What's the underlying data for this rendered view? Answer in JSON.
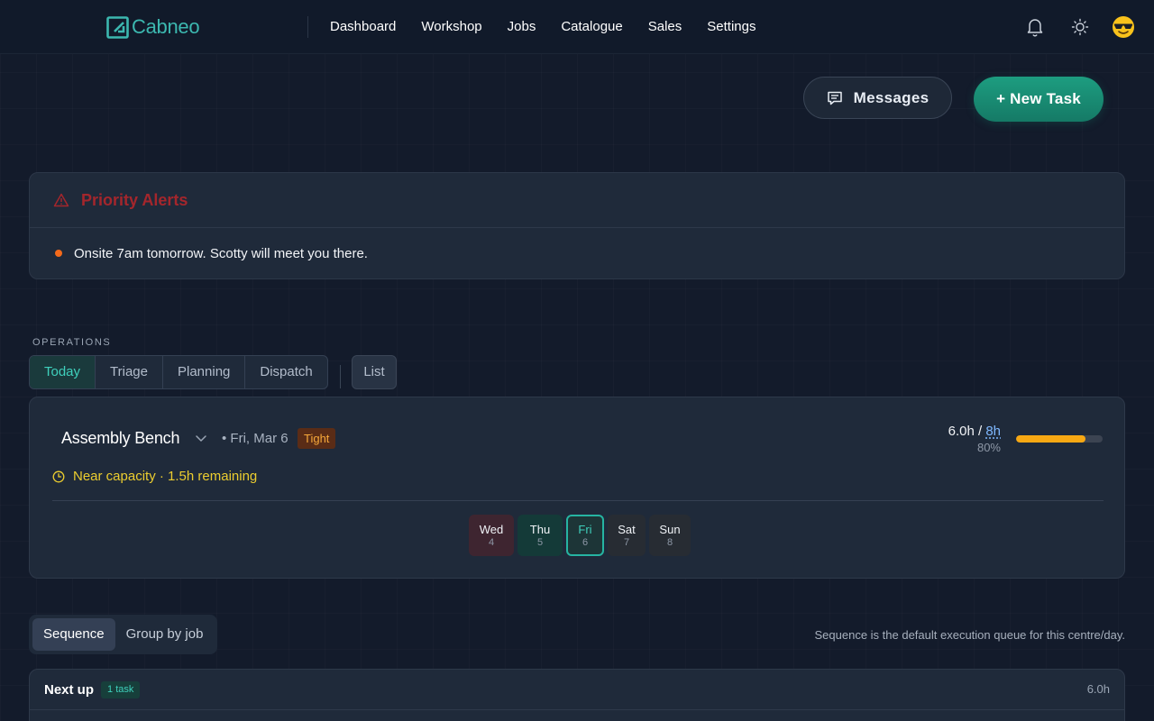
{
  "app": {
    "name": "Cabneo",
    "nav": [
      "Dashboard",
      "Workshop",
      "Jobs",
      "Catalogue",
      "Sales",
      "Settings"
    ]
  },
  "icons": {
    "logo": "cabneo-logo-icon",
    "notifications": "bell-icon",
    "theme": "sun-icon",
    "avatar": "sunglasses-emoji-avatar",
    "messages": "chat-bubble-icon",
    "alerts": "warning-triangle-icon",
    "bench_dropdown": "chevron-down-icon",
    "near_capacity": "clock-icon"
  },
  "actions": {
    "messages_label": "Messages",
    "new_task_label": "+ New Task"
  },
  "alerts": {
    "title": "Priority Alerts",
    "items": [
      "Onsite 7am tomorrow. Scotty will meet you there."
    ]
  },
  "operations": {
    "section_label": "OPERATIONS",
    "tabs": [
      "Today",
      "Triage",
      "Planning",
      "Dispatch"
    ],
    "active_tab": "Today",
    "list_label": "List"
  },
  "bench": {
    "title": "Assembly Bench",
    "date": "• Fri, Mar 6",
    "status_badge": "Tight",
    "hours_used": "6.0h /",
    "hours_max": "8h",
    "percent_label": "80%",
    "utilization": 0.8,
    "near_capacity_text": "Near capacity · 1.5h remaining",
    "days": [
      {
        "name": "Wed",
        "num": "4"
      },
      {
        "name": "Thu",
        "num": "5"
      },
      {
        "name": "Fri",
        "num": "6"
      },
      {
        "name": "Sat",
        "num": "7"
      },
      {
        "name": "Sun",
        "num": "8"
      }
    ],
    "selected_day": "Fri"
  },
  "sequence": {
    "modes": [
      "Sequence",
      "Group by job"
    ],
    "active_mode": "Sequence",
    "note": "Sequence is the default execution queue for this centre/day.",
    "next_up_title": "Next up",
    "next_up_badge": "1 task",
    "next_up_hours": "6.0h"
  },
  "colors": {
    "background": "#131b2b",
    "accent_teal": "#3fd0bc",
    "alert_red": "#a4262c",
    "capacity_orange": "#f7a813",
    "near_capacity_yellow": "#eccd2f",
    "primary_button": "#1d9d80"
  }
}
